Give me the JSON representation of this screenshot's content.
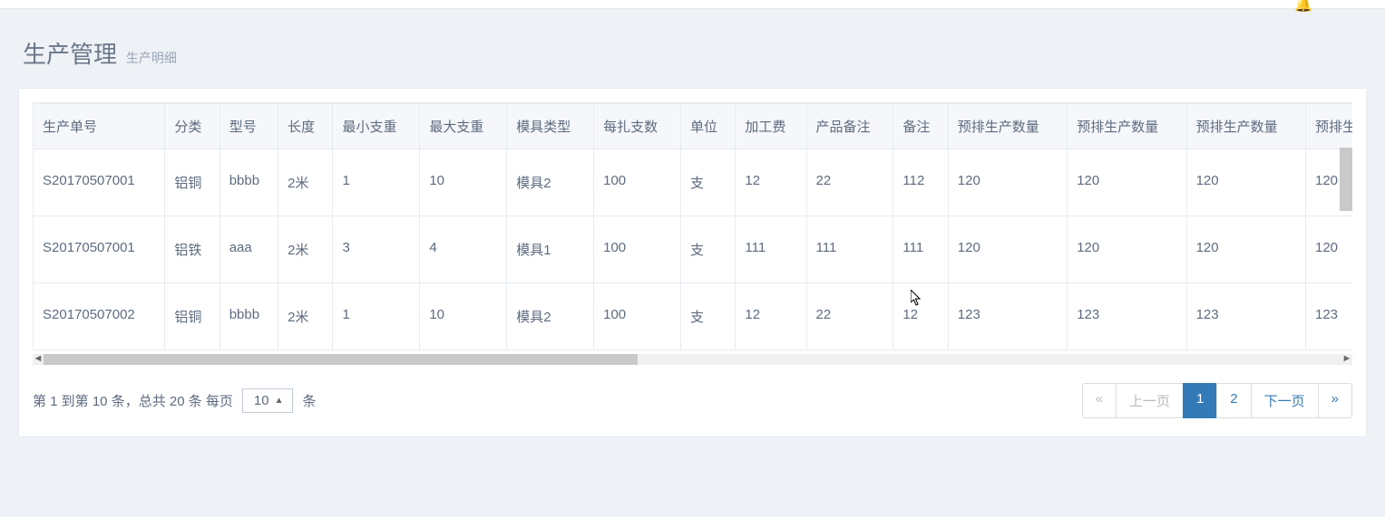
{
  "header": {
    "title": "生产管理",
    "subtitle": "生产明细"
  },
  "table": {
    "columns": [
      "生产单号",
      "分类",
      "型号",
      "长度",
      "最小支重",
      "最大支重",
      "模具类型",
      "每扎支数",
      "单位",
      "加工费",
      "产品备注",
      "备注",
      "预排生产数量",
      "预排生产数量",
      "预排生产数量",
      "预排生产"
    ],
    "rows": [
      [
        "S20170507001",
        "铝铜",
        "bbbb",
        "2米",
        "1",
        "10",
        "模具2",
        "100",
        "支",
        "12",
        "22",
        "112",
        "120",
        "120",
        "120",
        "120"
      ],
      [
        "S20170507001",
        "铝铁",
        "aaa",
        "2米",
        "3",
        "4",
        "模具1",
        "100",
        "支",
        "111",
        "111",
        "111",
        "120",
        "120",
        "120",
        "120"
      ],
      [
        "S20170507002",
        "铝铜",
        "bbbb",
        "2米",
        "1",
        "10",
        "模具2",
        "100",
        "支",
        "12",
        "22",
        "12",
        "123",
        "123",
        "123",
        "123"
      ]
    ]
  },
  "pagination": {
    "info_prefix": "第 1 到第 10 条，总共 20 条 每页",
    "page_size": "10",
    "info_suffix": "条",
    "first": "«",
    "prev": "上一页",
    "pages": [
      "1",
      "2"
    ],
    "active_page": "1",
    "next": "下一页",
    "last": "»"
  }
}
